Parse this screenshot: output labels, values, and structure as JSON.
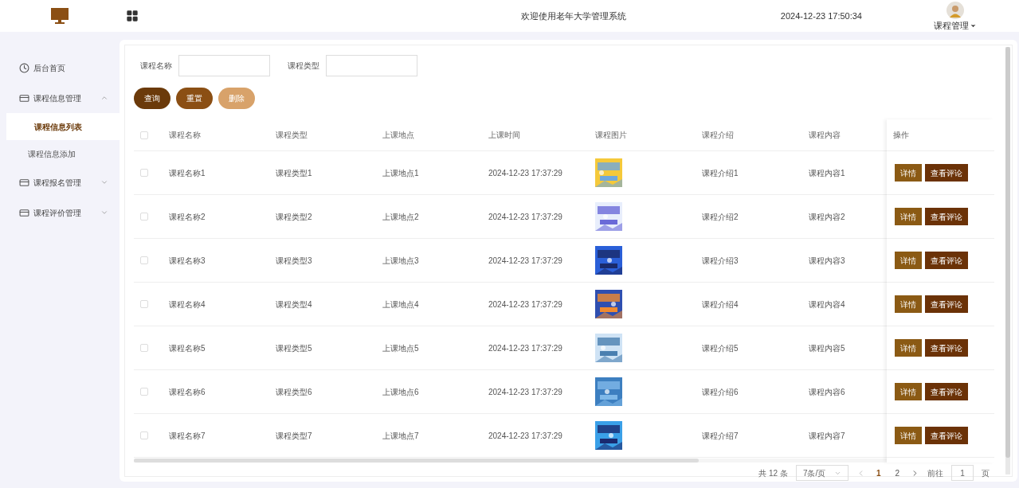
{
  "header": {
    "title": "欢迎使用老年大学管理系统",
    "datetime": "2024-12-23 17:50:34",
    "user_menu": "课程管理"
  },
  "sidebar": {
    "items": [
      {
        "label": "后台首页"
      },
      {
        "label": "课程信息管理",
        "expanded": true,
        "children": [
          {
            "label": "课程信息列表",
            "selected": true
          },
          {
            "label": "课程信息添加",
            "selected": false
          }
        ]
      },
      {
        "label": "课程报名管理",
        "expanded": false
      },
      {
        "label": "课程评价管理",
        "expanded": false
      }
    ]
  },
  "search": {
    "fields": [
      {
        "label": "课程名称"
      },
      {
        "label": "课程类型"
      }
    ],
    "buttons": [
      {
        "label": "查询",
        "kind": "query",
        "disabled": false
      },
      {
        "label": "重置",
        "kind": "reset",
        "disabled": false
      },
      {
        "label": "删除",
        "kind": "delete",
        "disabled": true
      }
    ]
  },
  "table": {
    "select_all_checked": false,
    "columns": [
      "课程名称",
      "课程类型",
      "上课地点",
      "上课时间",
      "课程图片",
      "课程介绍",
      "课程内容",
      "操作"
    ],
    "rows": [
      {
        "checked": false,
        "name": "课程名称1",
        "type": "课程类型1",
        "place": "上课地点1",
        "time": "2024-12-23 17:37:29",
        "picture": {
          "kind": "picture"
        },
        "intro": "课程介绍1",
        "content": "课程内容1",
        "actions": [
          "详情",
          "查看评论"
        ]
      },
      {
        "checked": false,
        "name": "课程名称2",
        "type": "课程类型2",
        "place": "上课地点2",
        "time": "2024-12-23 17:37:29",
        "picture": {
          "kind": "picture"
        },
        "intro": "课程介绍2",
        "content": "课程内容2",
        "actions": [
          "详情",
          "查看评论"
        ]
      },
      {
        "checked": false,
        "name": "课程名称3",
        "type": "课程类型3",
        "place": "上课地点3",
        "time": "2024-12-23 17:37:29",
        "picture": {
          "kind": "picture"
        },
        "intro": "课程介绍3",
        "content": "课程内容3",
        "actions": [
          "详情",
          "查看评论"
        ]
      },
      {
        "checked": false,
        "name": "课程名称4",
        "type": "课程类型4",
        "place": "上课地点4",
        "time": "2024-12-23 17:37:29",
        "picture": {
          "kind": "picture"
        },
        "intro": "课程介绍4",
        "content": "课程内容4",
        "actions": [
          "详情",
          "查看评论"
        ]
      },
      {
        "checked": false,
        "name": "课程名称5",
        "type": "课程类型5",
        "place": "上课地点5",
        "time": "2024-12-23 17:37:29",
        "picture": {
          "kind": "picture"
        },
        "intro": "课程介绍5",
        "content": "课程内容5",
        "actions": [
          "详情",
          "查看评论"
        ]
      },
      {
        "checked": false,
        "name": "课程名称6",
        "type": "课程类型6",
        "place": "上课地点6",
        "time": "2024-12-23 17:37:29",
        "picture": {
          "kind": "picture"
        },
        "intro": "课程介绍6",
        "content": "课程内容6",
        "actions": [
          "详情",
          "查看评论"
        ]
      },
      {
        "checked": false,
        "name": "课程名称7",
        "type": "课程类型7",
        "place": "上课地点7",
        "time": "2024-12-23 17:37:29",
        "picture": {
          "kind": "picture"
        },
        "intro": "课程介绍7",
        "content": "课程内容7",
        "actions": [
          "详情",
          "查看评论"
        ]
      }
    ]
  },
  "pagination": {
    "total": "共 12 条",
    "page_size": "7条/页",
    "pages": [
      {
        "label": "1",
        "selected": true
      },
      {
        "label": "2",
        "selected": false
      }
    ],
    "goto_label": "前往",
    "goto_value": "1",
    "goto_suffix": "页"
  }
}
